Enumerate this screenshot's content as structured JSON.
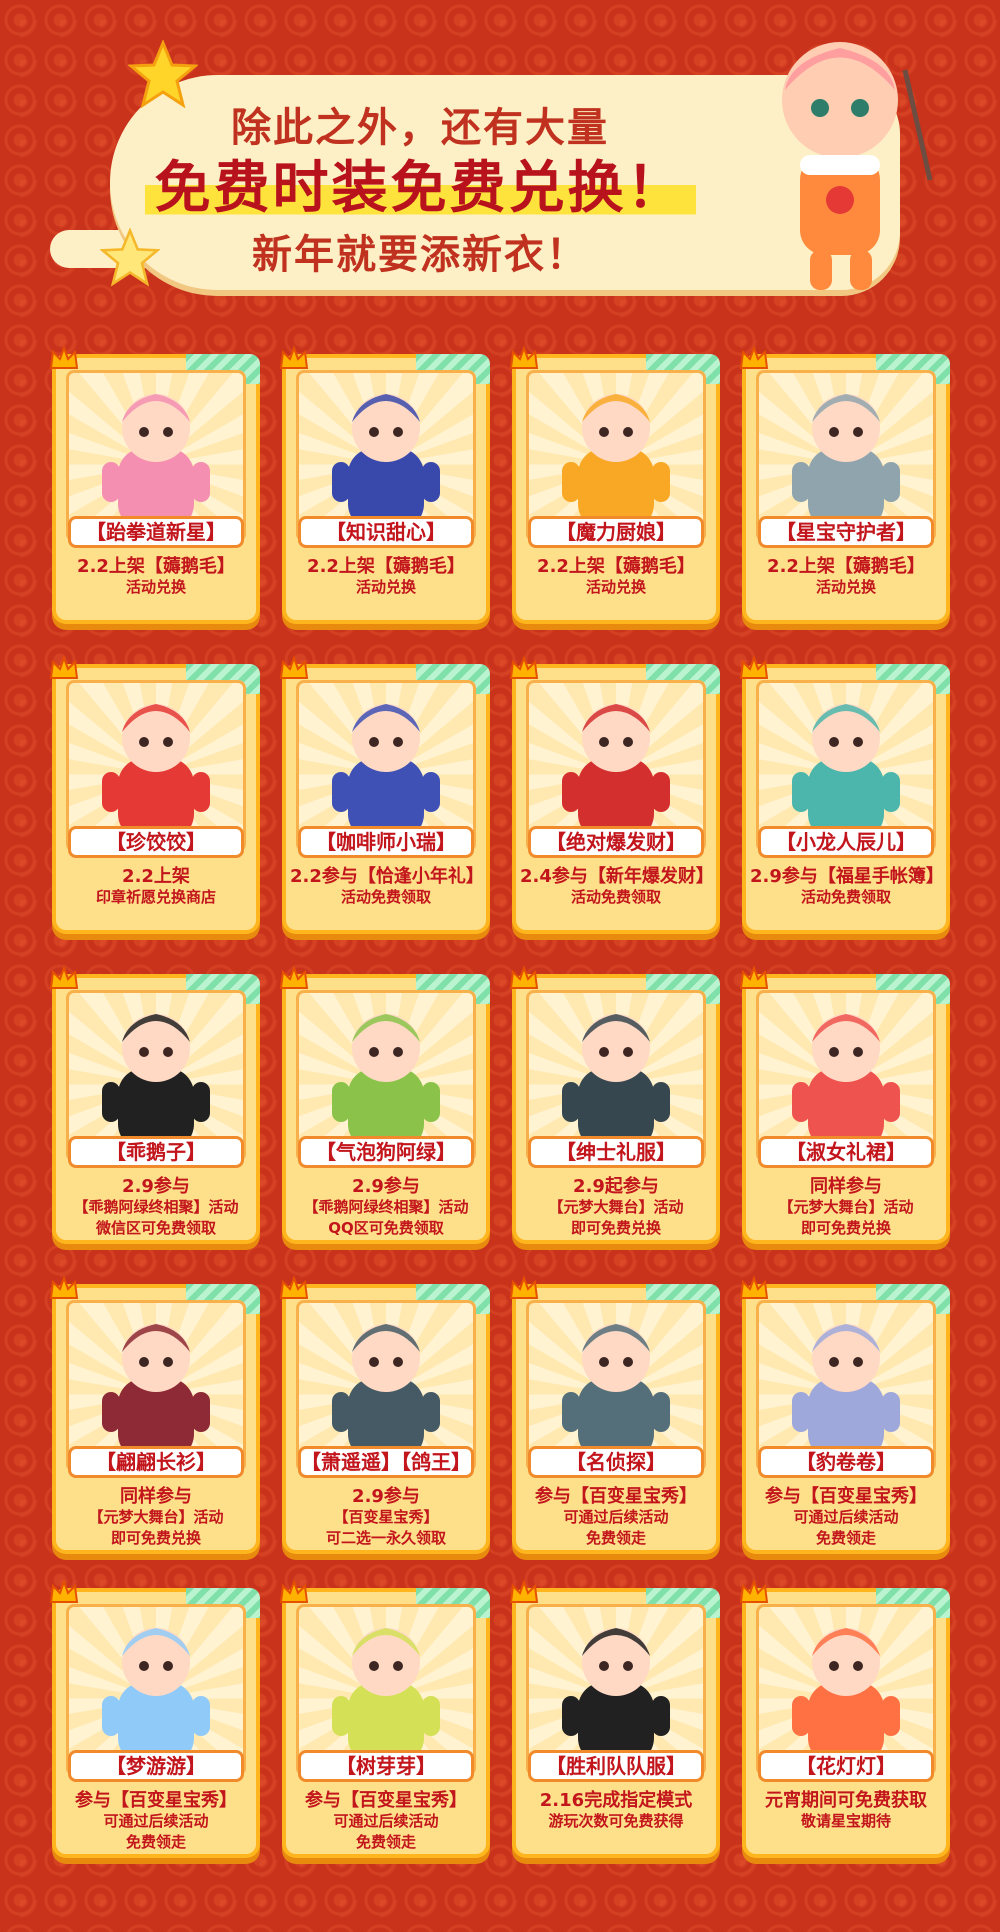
{
  "header": {
    "line1": "除此之外，还有大量",
    "line2": "免费时装免费兑换！",
    "line3": "新年就要添新衣！"
  },
  "colors": {
    "background": "#c9331c",
    "card": "#ffe08a",
    "text_red": "#c2151c",
    "banner": "#fdf0c6"
  },
  "cards": [
    {
      "name": "【跆拳道新星】",
      "l1": "2.2上架【薅鹅毛】",
      "l2": "活动兑换",
      "l3": "",
      "art": "taekwondo-outfit",
      "color": "#f48fb1"
    },
    {
      "name": "【知识甜心】",
      "l1": "2.2上架【薅鹅毛】",
      "l2": "活动兑换",
      "l3": "",
      "art": "graduate-outfit",
      "color": "#3949ab"
    },
    {
      "name": "【魔力厨娘】",
      "l1": "2.2上架【薅鹅毛】",
      "l2": "活动兑换",
      "l3": "",
      "art": "chef-outfit",
      "color": "#f9a825"
    },
    {
      "name": "【星宝守护者】",
      "l1": "2.2上架【薅鹅毛】",
      "l2": "活动兑换",
      "l3": "",
      "art": "guard-outfit",
      "color": "#90a4ae"
    },
    {
      "name": "【珍饺饺】",
      "l1": "2.2上架",
      "l2": "印章祈愿兑换商店",
      "l3": "",
      "art": "dumpling-outfit",
      "color": "#e53935"
    },
    {
      "name": "【咖啡师小瑞】",
      "l1": "2.2参与【恰逢小年礼】",
      "l2": "活动免费领取",
      "l3": "",
      "art": "barista-outfit",
      "color": "#3f51b5"
    },
    {
      "name": "【绝对爆发财】",
      "l1": "2.4参与【新年爆发财】",
      "l2": "活动免费领取",
      "l3": "",
      "art": "duck-fortune-outfit",
      "color": "#d32f2f"
    },
    {
      "name": "【小龙人辰儿】",
      "l1": "2.9参与【福星手帐簿】",
      "l2": "活动免费领取",
      "l3": "",
      "art": "dragon-outfit",
      "color": "#4db6ac"
    },
    {
      "name": "【乖鹅子】",
      "l1": "2.9参与",
      "l2": "【乖鹅阿绿终相聚】活动",
      "l3": "微信区可免费领取",
      "art": "penguin-outfit",
      "color": "#212121"
    },
    {
      "name": "【气泡狗阿绿】",
      "l1": "2.9参与",
      "l2": "【乖鹅阿绿终相聚】活动",
      "l3": "QQ区可免费领取",
      "art": "green-dog-outfit",
      "color": "#8bc34a"
    },
    {
      "name": "【绅士礼服】",
      "l1": "2.9起参与",
      "l2": "【元梦大舞台】活动",
      "l3": "即可免费兑换",
      "art": "husky-tux-outfit",
      "color": "#37474f"
    },
    {
      "name": "【淑女礼裙】",
      "l1": "同样参与",
      "l2": "【元梦大舞台】活动",
      "l3": "即可免费兑换",
      "art": "lady-dress-outfit",
      "color": "#ef5350"
    },
    {
      "name": "【翩翩长衫】",
      "l1": "同样参与",
      "l2": "【元梦大舞台】活动",
      "l3": "即可免费兑换",
      "art": "husky-robe-outfit",
      "color": "#8d2a35"
    },
    {
      "name": "【萧遥遥】【鸽王】",
      "l1": "2.9参与",
      "l2": "【百变星宝秀】",
      "l3": "可二选一永久领取",
      "art": "swordsman-pigeon-outfit",
      "color": "#455a64"
    },
    {
      "name": "【名侦探】",
      "l1": "参与【百变星宝秀】",
      "l2": "可通过后续活动",
      "l3": "免费领走",
      "art": "detective-outfit",
      "color": "#546e7a"
    },
    {
      "name": "【豹卷卷】",
      "l1": "参与【百变星宝秀】",
      "l2": "可通过后续活动",
      "l3": "免费领走",
      "art": "leopard-ski-outfit",
      "color": "#9fa8da"
    },
    {
      "name": "【梦游游】",
      "l1": "参与【百变星宝秀】",
      "l2": "可通过后续活动",
      "l3": "免费领走",
      "art": "sleepwalker-outfit",
      "color": "#90caf9"
    },
    {
      "name": "【树芽芽】",
      "l1": "参与【百变星宝秀】",
      "l2": "可通过后续活动",
      "l3": "免费领走",
      "art": "sprout-outfit",
      "color": "#d4e157"
    },
    {
      "name": "【胜利队队服】",
      "l1": "2.16完成指定模式",
      "l2": "游玩次数可免费获得",
      "l3": "",
      "art": "victory-team-outfit",
      "color": "#212121"
    },
    {
      "name": "【花灯灯】",
      "l1": "元宵期间可免费获取",
      "l2": "敬请星宝期待",
      "l3": "",
      "art": "lantern-outfit",
      "color": "#ff7043"
    }
  ]
}
